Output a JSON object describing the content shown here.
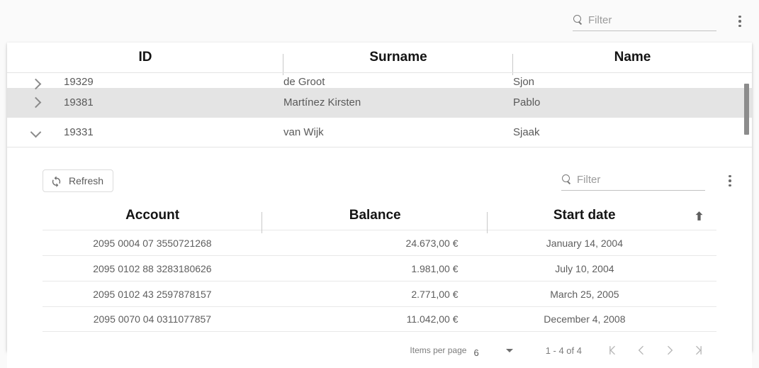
{
  "outer_toolbar": {
    "filter_placeholder": "Filter",
    "filter_value": "",
    "search_icon": "search-icon",
    "menu_icon": "more-vert-icon"
  },
  "outer_table": {
    "columns": [
      {
        "key": "id",
        "label": "ID"
      },
      {
        "key": "surname",
        "label": "Surname"
      },
      {
        "key": "name",
        "label": "Name"
      }
    ],
    "rows": [
      {
        "expand_icon": "chevron-right-icon",
        "id": "19329",
        "surname": "de Groot",
        "name": "Sjon",
        "selected": false,
        "expanded": false
      },
      {
        "expand_icon": "chevron-right-icon",
        "id": "19381",
        "surname": "Martínez Kirsten",
        "name": "Pablo",
        "selected": true,
        "expanded": false
      },
      {
        "expand_icon": "chevron-down-icon",
        "id": "19331",
        "surname": "van Wijk",
        "name": "Sjaak",
        "selected": false,
        "expanded": true
      }
    ],
    "scrollbar": "vertical-scrollbar"
  },
  "inner_toolbar": {
    "refresh_label": "Refresh",
    "refresh_icon": "sync-icon",
    "filter_placeholder": "Filter",
    "filter_value": "",
    "search_icon": "search-icon",
    "menu_icon": "more-vert-icon"
  },
  "inner_table": {
    "columns": [
      {
        "key": "account",
        "label": "Account"
      },
      {
        "key": "balance",
        "label": "Balance"
      },
      {
        "key": "start_date",
        "label": "Start date"
      }
    ],
    "sort_icon": "arrow-upward-icon",
    "sort_direction": "asc",
    "rows": [
      {
        "account": "2095 0004 07 3550721268",
        "balance": "24.673,00 €",
        "start_date": "January 14, 2004"
      },
      {
        "account": "2095 0102 88 3283180626",
        "balance": "1.981,00 €",
        "start_date": "July 10, 2004"
      },
      {
        "account": "2095 0102 43 2597878157",
        "balance": "2.771,00 €",
        "start_date": "March 25, 2005"
      },
      {
        "account": "2095 0070 04 0311077857",
        "balance": "11.042,00 €",
        "start_date": "December 4, 2008"
      }
    ]
  },
  "paginator": {
    "items_per_page_label": "Items per page",
    "items_per_page_value": "6",
    "range_label": "1 - 4 of 4",
    "first_page_icon": "first-page-icon",
    "prev_page_icon": "chevron-left-icon",
    "next_page_icon": "chevron-right-icon",
    "last_page_icon": "last-page-icon"
  }
}
